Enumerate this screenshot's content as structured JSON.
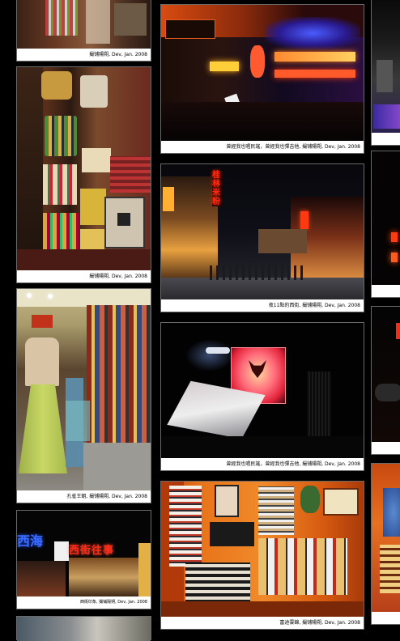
{
  "photos": {
    "p1": {
      "caption": "撮铺陽朔, Dev, Jan. 2008"
    },
    "p2": {
      "caption": "撮铺陽朔, Dev, Jan. 2008"
    },
    "p3": {
      "caption": "孔雀王朝, 撮铺陽朔, Dev, Jan. 2008"
    },
    "p4": {
      "caption": "西街印象, 撮铺陽朔, Dev, Jan. 2008",
      "sign_left": "西海",
      "sign_main": "西街往事"
    },
    "p5": {
      "caption": "曾經我也唱民謠，曾經我也彈吉他, 撮铺陽朔, Dev, Jan. 2008"
    },
    "p6": {
      "caption": "夜11點的西街, 撮铺陽朔, Dev, Jan. 2008",
      "sign_vertical": "桂林米粉"
    },
    "p7": {
      "caption": "曾經我也唱民謠，曾經我也彈吉他, 撮铺陽朔, Dev, Jan. 2008"
    },
    "p8": {
      "caption": "富途雲錦, 撮铺陽朔, Dev, Jan. 2008"
    }
  },
  "colors": {
    "page_bg": "#000000",
    "caption_bg": "#ffffff",
    "border": "#6a6a6a"
  }
}
